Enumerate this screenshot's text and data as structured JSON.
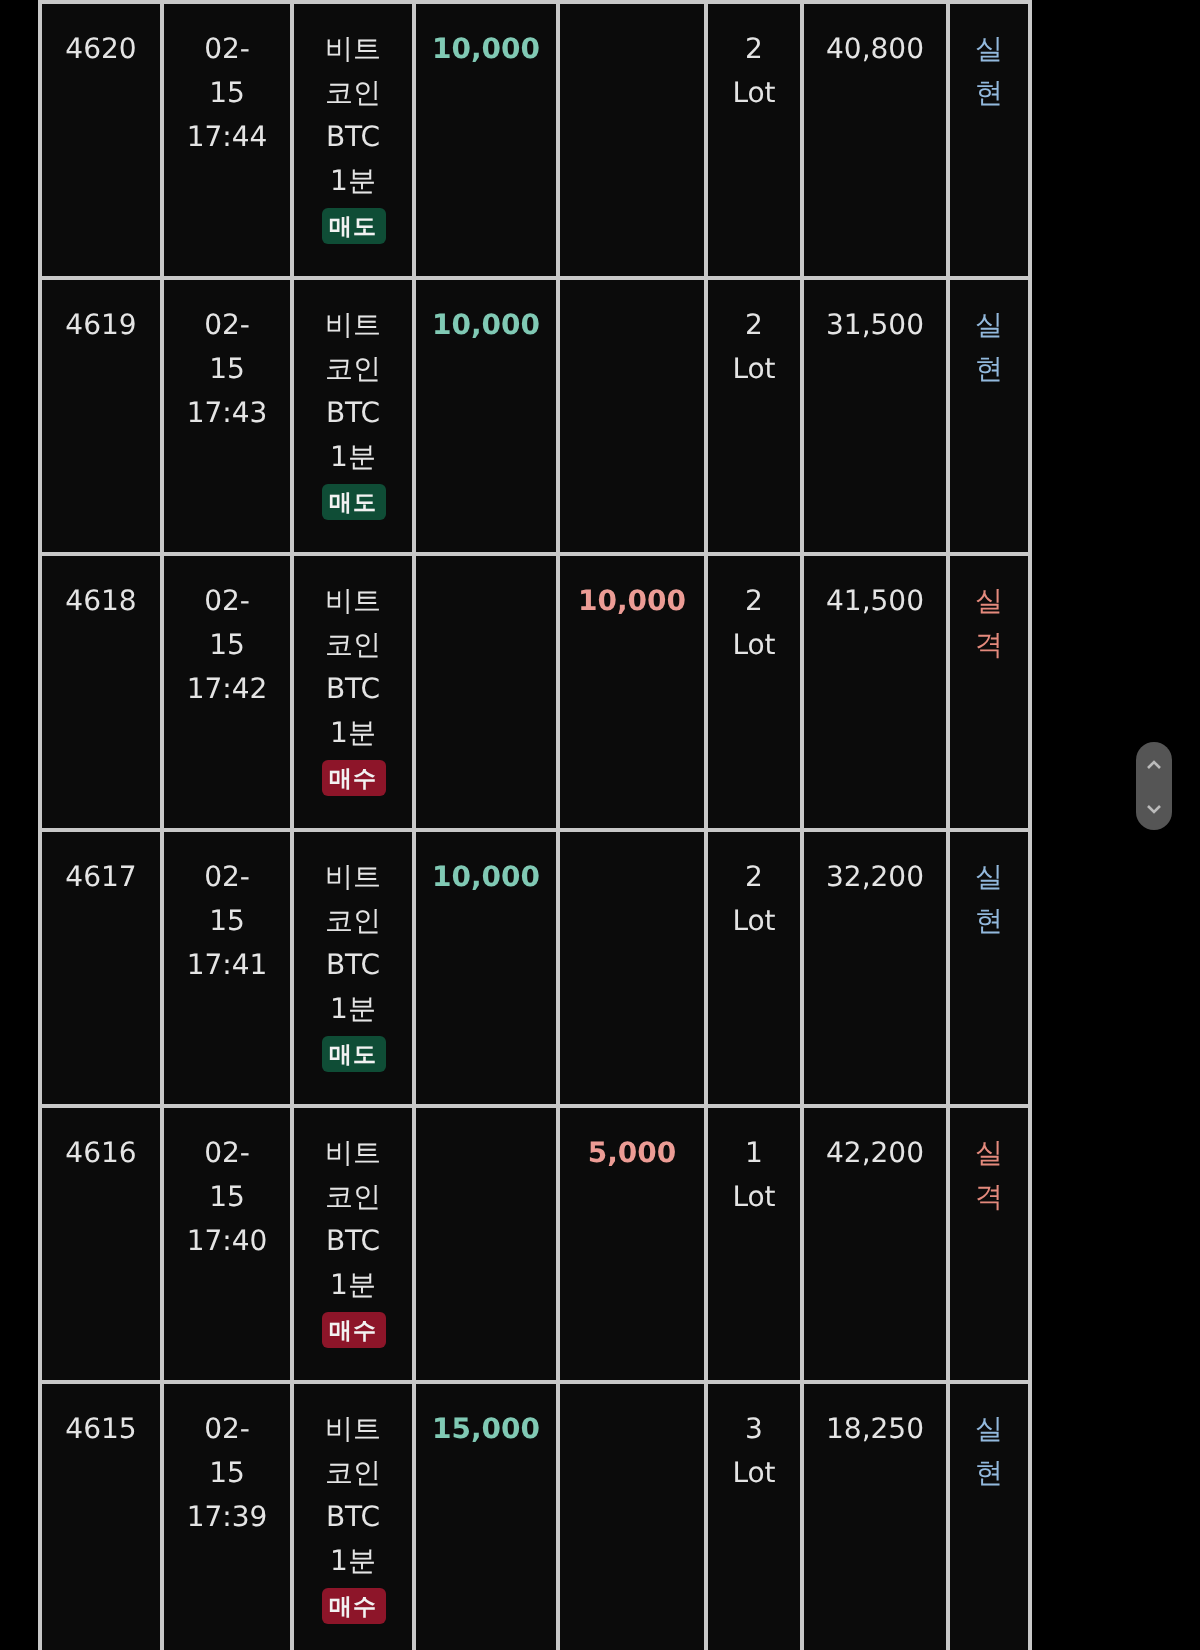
{
  "rows": [
    {
      "no": "4620",
      "date": "02-15",
      "time": "17:44",
      "name": "비트코인",
      "symbol": "BTC",
      "timeframe": "1분",
      "side": {
        "label": "매도",
        "kind": "sell"
      },
      "column_5": "10,000",
      "quantity": "2 Lot",
      "price": "40,800",
      "result": {
        "text": "실현",
        "kind": "realized"
      }
    },
    {
      "no": "4619",
      "date": "02-15",
      "time": "17:43",
      "name": "비트코인",
      "symbol": "BTC",
      "timeframe": "1분",
      "side": {
        "label": "매도",
        "kind": "sell"
      },
      "column_5": "10,000",
      "quantity": "2 Lot",
      "price": "31,500",
      "result": {
        "text": "실현",
        "kind": "realized"
      }
    },
    {
      "no": "4618",
      "date": "02-15",
      "time": "17:42",
      "name": "비트코인",
      "symbol": "BTC",
      "timeframe": "1분",
      "side": {
        "label": "매수",
        "kind": "buy"
      },
      "column_6": "10,000",
      "quantity": "2 Lot",
      "price": "41,500",
      "result": {
        "text": "실격",
        "kind": "failed"
      }
    },
    {
      "no": "4617",
      "date": "02-15",
      "time": "17:41",
      "name": "비트코인",
      "symbol": "BTC",
      "timeframe": "1분",
      "side": {
        "label": "매도",
        "kind": "sell"
      },
      "column_5": "10,000",
      "quantity": "2 Lot",
      "price": "32,200",
      "result": {
        "text": "실현",
        "kind": "realized"
      }
    },
    {
      "no": "4616",
      "date": "02-15",
      "time": "17:40",
      "name": "비트코인",
      "symbol": "BTC",
      "timeframe": "1분",
      "side": {
        "label": "매수",
        "kind": "buy"
      },
      "column_6": "5,000",
      "quantity": "1 Lot",
      "price": "42,200",
      "result": {
        "text": "실격",
        "kind": "failed"
      }
    },
    {
      "no": "4615",
      "date": "02-15",
      "time": "17:39",
      "name": "비트코인",
      "symbol": "BTC",
      "timeframe": "1분",
      "side": {
        "label": "매수",
        "kind": "buy"
      },
      "column_5": "15,000",
      "quantity": "3 Lot",
      "price": "18,250",
      "result": {
        "text": "실현",
        "kind": "realized"
      }
    }
  ]
}
